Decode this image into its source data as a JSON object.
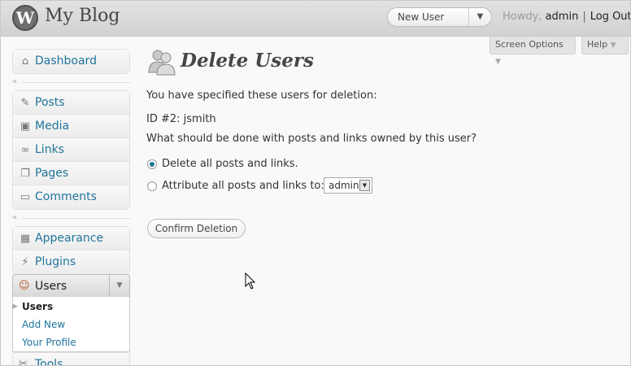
{
  "header": {
    "logo": "W",
    "site_title": "My Blog",
    "favorite_action": "New User",
    "greeting": "Howdy,",
    "username": "admin",
    "separator": "|",
    "logout": "Log Out"
  },
  "screen_meta": {
    "screen_options": "Screen Options",
    "help": "Help"
  },
  "sidebar": {
    "group1": [
      {
        "label": "Dashboard",
        "icon": "dashboard-icon"
      }
    ],
    "group2": [
      {
        "label": "Posts",
        "icon": "pin-icon"
      },
      {
        "label": "Media",
        "icon": "media-icon"
      },
      {
        "label": "Links",
        "icon": "link-icon"
      },
      {
        "label": "Pages",
        "icon": "pages-icon"
      },
      {
        "label": "Comments",
        "icon": "comment-icon"
      }
    ],
    "group3": [
      {
        "label": "Appearance",
        "icon": "appearance-icon"
      },
      {
        "label": "Plugins",
        "icon": "plugin-icon"
      }
    ],
    "users": {
      "label": "Users",
      "submenu": [
        "Users",
        "Add New",
        "Your Profile"
      ]
    },
    "tools": {
      "label": "Tools"
    }
  },
  "main": {
    "title": "Delete Users",
    "intro": "You have specified these users for deletion:",
    "user_entry": "ID #2: jsmith",
    "question": "What should be done with posts and links owned by this user?",
    "option_delete": "Delete all posts and links.",
    "option_attribute": "Attribute all posts and links to:",
    "selected_option": "delete",
    "attribute_select_value": "admin",
    "confirm_button": "Confirm Deletion"
  }
}
